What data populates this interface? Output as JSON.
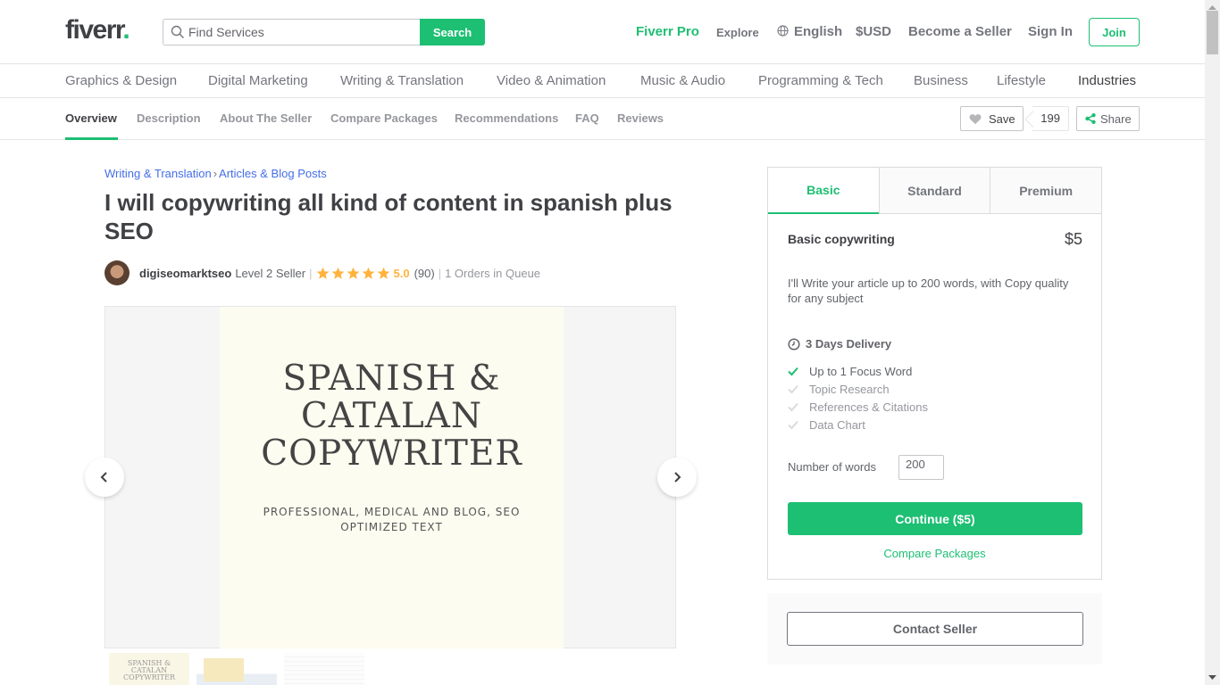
{
  "header": {
    "logo_text": "fiverr",
    "logo_dot": ".",
    "search_placeholder": "Find Services",
    "search_value": "",
    "search_button": "Search",
    "nav": {
      "fiverr_pro": "Fiverr Pro",
      "explore": "Explore",
      "language": "English",
      "currency": "$USD",
      "become_seller": "Become a Seller",
      "sign_in": "Sign In",
      "join": "Join"
    }
  },
  "categories": [
    "Graphics & Design",
    "Digital Marketing",
    "Writing & Translation",
    "Video & Animation",
    "Music & Audio",
    "Programming & Tech",
    "Business",
    "Lifestyle",
    "Industries"
  ],
  "sub_nav": {
    "items": [
      "Overview",
      "Description",
      "About The Seller",
      "Compare Packages",
      "Recommendations",
      "FAQ",
      "Reviews"
    ],
    "active": "Overview",
    "save_label": "Save",
    "save_count": "199",
    "share_label": "Share"
  },
  "gig": {
    "breadcrumb": [
      "Writing & Translation",
      "Articles & Blog Posts"
    ],
    "breadcrumb_sep": "›",
    "title": "I will copywriting all kind of content in spanish plus SEO",
    "seller": {
      "username": "digiseomarktseo",
      "level": "Level 2 Seller",
      "stars": 5,
      "rating": "5.0",
      "reviews": "(90)",
      "queue": "1 Orders in Queue"
    },
    "gallery": {
      "slide_title_lines": [
        "SPANISH &",
        "CATALAN",
        "COPYWRITER"
      ],
      "slide_subtitle_lines": [
        "PROFESSIONAL, MEDICAL AND BLOG, SEO",
        "OPTIMIZED TEXT"
      ],
      "thumb1_text": "SPANISH & CATALAN COPYWRITER"
    }
  },
  "package": {
    "tabs": [
      "Basic",
      "Standard",
      "Premium"
    ],
    "active_tab": "Basic",
    "name": "Basic copywriting",
    "price": "$5",
    "description": "I'll Write your article up to 200 words, with Copy quality for any subject",
    "delivery": "3 Days Delivery",
    "features": [
      {
        "label": "Up to 1 Focus Word",
        "included": true
      },
      {
        "label": "Topic Research",
        "included": false
      },
      {
        "label": "References & Citations",
        "included": false
      },
      {
        "label": "Data Chart",
        "included": false
      }
    ],
    "words_label": "Number of words",
    "words_value": "200",
    "continue_button": "Continue ($5)",
    "compare_link": "Compare Packages",
    "contact_button": "Contact Seller"
  },
  "colors": {
    "brand_green": "#1dbf73",
    "link_blue": "#446ee7",
    "star_yellow": "#ffb33e",
    "text_dark": "#404145"
  }
}
